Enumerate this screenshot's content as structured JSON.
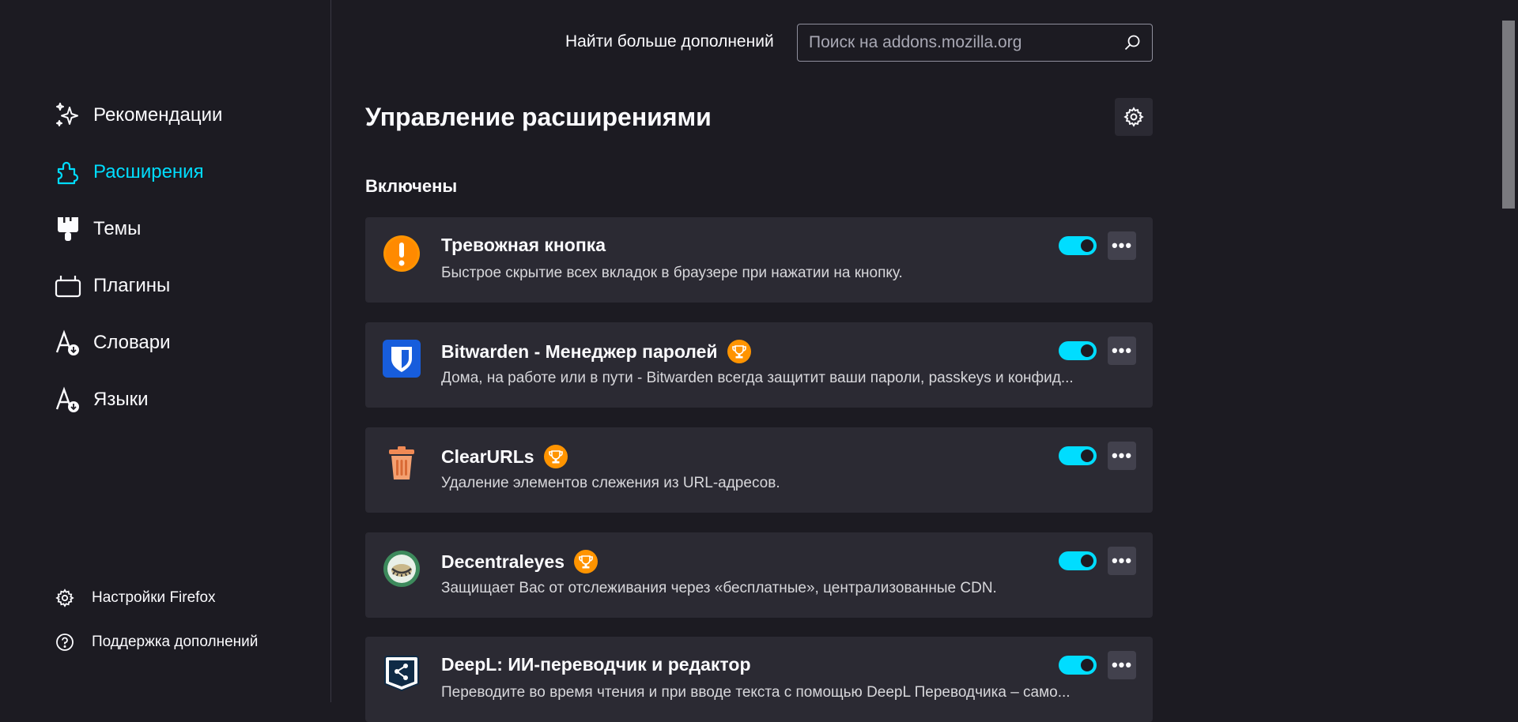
{
  "sidebar": {
    "categories": [
      {
        "label": "Рекомендации",
        "icon": "sparkles-icon"
      },
      {
        "label": "Расширения",
        "icon": "puzzle-piece-icon",
        "active": true
      },
      {
        "label": "Темы",
        "icon": "paintbrush-icon"
      },
      {
        "label": "Плагины",
        "icon": "plugin-icon"
      },
      {
        "label": "Словари",
        "icon": "dictionary-icon"
      },
      {
        "label": "Языки",
        "icon": "language-icon"
      }
    ],
    "footer": [
      {
        "label": "Настройки Firefox",
        "icon": "gear-icon"
      },
      {
        "label": "Поддержка дополнений",
        "icon": "help-icon"
      }
    ]
  },
  "header": {
    "find_more_label": "Найти больше дополнений",
    "search_placeholder": "Поиск на addons.mozilla.org"
  },
  "page_title": "Управление расширениями",
  "section_heading": "Включены",
  "extensions": [
    {
      "name": "Тревожная кнопка",
      "description": "Быстрое скрытие всех вкладок в браузере при нажатии на кнопку.",
      "icon": "warning-icon",
      "recommended": false,
      "enabled": true
    },
    {
      "name": "Bitwarden - Менеджер паролей",
      "description": "Дома, на работе или в пути - Bitwarden всегда защитит ваши пароли, passkeys и конфид...",
      "icon": "bitwarden-shield-icon",
      "recommended": true,
      "enabled": true
    },
    {
      "name": "ClearURLs",
      "description": "Удаление элементов слежения из URL-адресов.",
      "icon": "trash-can-icon",
      "recommended": true,
      "enabled": true
    },
    {
      "name": "Decentraleyes",
      "description": "Защищает Вас от отслеживания через «бесплатные», централизованные CDN.",
      "icon": "decentraleyes-icon",
      "recommended": true,
      "enabled": true
    },
    {
      "name": "DeepL: ИИ-переводчик и редактор",
      "description": "Переводите во время чтения и при вводе текста с помощью DeepL Переводчика – само...",
      "icon": "deepl-icon",
      "recommended": false,
      "enabled": true
    }
  ],
  "more_button_label": "•••",
  "colors": {
    "background": "#1c1b22",
    "card": "#2b2a33",
    "accent": "#00ddff",
    "badge": "#ff9400",
    "text": "#fbfbfe"
  }
}
